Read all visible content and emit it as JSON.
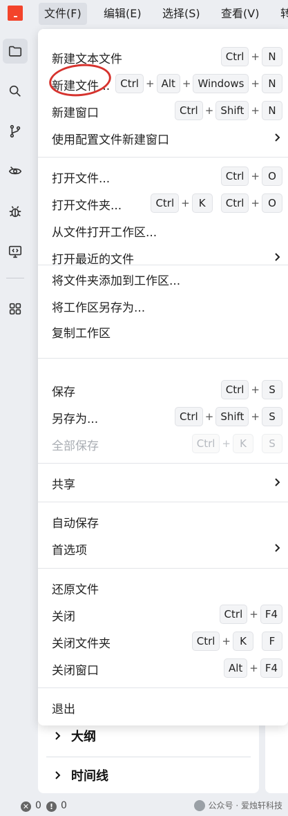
{
  "menubar": {
    "items": [
      {
        "label": "文件(F)"
      },
      {
        "label": "编辑(E)"
      },
      {
        "label": "选择(S)"
      },
      {
        "label": "查看(V)"
      },
      {
        "label": "转"
      }
    ]
  },
  "activity_bar": {
    "icons": [
      "explorer-icon",
      "search-icon",
      "source-control-icon",
      "watch-icon",
      "debug-icon",
      "remote-icon",
      "extensions-icon"
    ]
  },
  "file_menu": {
    "items": [
      {
        "label": "新建文本文件",
        "keys": [
          [
            "Ctrl",
            "N"
          ]
        ]
      },
      {
        "label": "新建文件...",
        "keys": [
          [
            "Ctrl",
            "Alt",
            "Windows",
            "N"
          ]
        ]
      },
      {
        "label": "新建窗口",
        "keys": [
          [
            "Ctrl",
            "Shift",
            "N"
          ]
        ]
      },
      {
        "label": "使用配置文件新建窗口",
        "submenu": true
      },
      {
        "label": "打开文件...",
        "keys": [
          [
            "Ctrl",
            "O"
          ]
        ]
      },
      {
        "label": "打开文件夹...",
        "keys": [
          [
            "Ctrl",
            "K"
          ],
          [
            "Ctrl",
            "O"
          ]
        ]
      },
      {
        "label": "从文件打开工作区..."
      },
      {
        "label": "打开最近的文件",
        "submenu": true
      },
      {
        "label": "将文件夹添加到工作区..."
      },
      {
        "label": "将工作区另存为..."
      },
      {
        "label": "复制工作区"
      },
      {
        "label": "保存",
        "keys": [
          [
            "Ctrl",
            "S"
          ]
        ]
      },
      {
        "label": "另存为...",
        "keys": [
          [
            "Ctrl",
            "Shift",
            "S"
          ]
        ]
      },
      {
        "label": "全部保存",
        "keys": [
          [
            "Ctrl",
            "K"
          ],
          [
            "S"
          ]
        ],
        "disabled": true
      },
      {
        "label": "共享",
        "submenu": true
      },
      {
        "label": "自动保存"
      },
      {
        "label": "首选项",
        "submenu": true
      },
      {
        "label": "还原文件"
      },
      {
        "label": "关闭",
        "keys": [
          [
            "Ctrl",
            "F4"
          ]
        ]
      },
      {
        "label": "关闭文件夹",
        "keys": [
          [
            "Ctrl",
            "K"
          ],
          [
            "F"
          ]
        ]
      },
      {
        "label": "关闭窗口",
        "keys": [
          [
            "Alt",
            "F4"
          ]
        ]
      },
      {
        "label": "退出"
      }
    ]
  },
  "side_panel": {
    "outline_label": "大纲",
    "timeline_label": "时间线"
  },
  "statusbar": {
    "errors": "0",
    "warnings": "0",
    "watermark": "公众号 · 爱烛轩科技"
  },
  "colors": {
    "logo": "#f3442b",
    "annotation_circle": "#d6332e",
    "background": "#eceef2"
  }
}
